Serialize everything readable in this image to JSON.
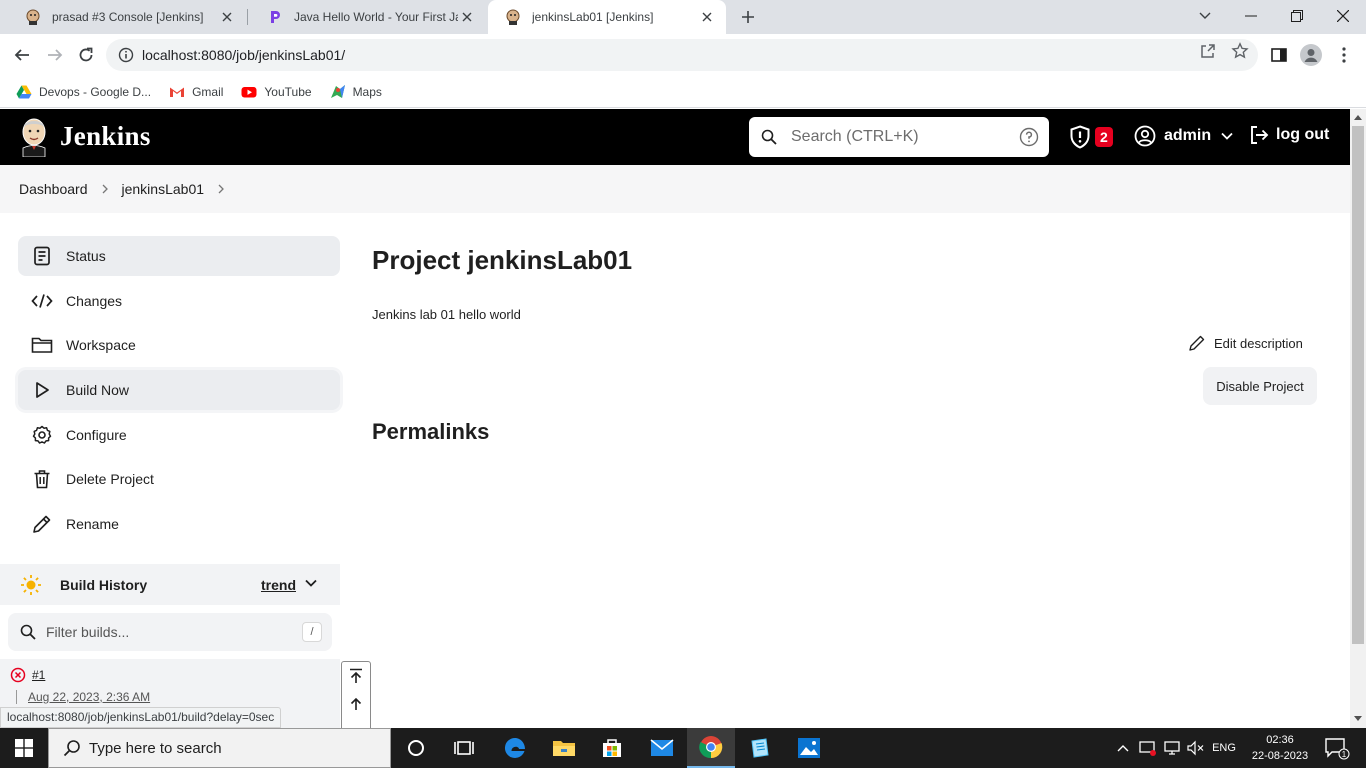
{
  "browser": {
    "tabs": [
      {
        "title": "prasad #3 Console [Jenkins]",
        "active": false
      },
      {
        "title": "Java Hello World - Your First Java",
        "active": false
      },
      {
        "title": "jenkinsLab01 [Jenkins]",
        "active": true
      }
    ],
    "url": "localhost:8080/job/jenkinsLab01/",
    "bookmarks": [
      {
        "label": "Devops - Google D...",
        "icon": "google-drive-icon"
      },
      {
        "label": "Gmail",
        "icon": "gmail-icon"
      },
      {
        "label": "YouTube",
        "icon": "youtube-icon"
      },
      {
        "label": "Maps",
        "icon": "maps-icon"
      }
    ],
    "status_url": "localhost:8080/job/jenkinsLab01/build?delay=0sec"
  },
  "jenkins": {
    "app_name": "Jenkins",
    "search_placeholder": "Search (CTRL+K)",
    "security_count": "2",
    "user": "admin",
    "logout": "log out",
    "breadcrumb": [
      "Dashboard",
      "jenkinsLab01"
    ],
    "sidebar": [
      {
        "label": "Status",
        "icon": "status-icon"
      },
      {
        "label": "Changes",
        "icon": "code-icon"
      },
      {
        "label": "Workspace",
        "icon": "folder-icon"
      },
      {
        "label": "Build Now",
        "icon": "play-icon"
      },
      {
        "label": "Configure",
        "icon": "gear-icon"
      },
      {
        "label": "Delete Project",
        "icon": "trash-icon"
      },
      {
        "label": "Rename",
        "icon": "pencil-icon"
      }
    ],
    "build_history": {
      "title": "Build History",
      "trend": "trend",
      "filter_placeholder": "Filter builds...",
      "filter_shortcut": "/",
      "builds": [
        {
          "number": "#1",
          "date": "Aug 22, 2023, 2:36 AM",
          "status": "failed"
        }
      ]
    },
    "project": {
      "title": "Project jenkinsLab01",
      "description": "Jenkins lab 01 hello world",
      "edit_description": "Edit description",
      "disable_button": "Disable Project",
      "permalinks_heading": "Permalinks"
    }
  },
  "taskbar": {
    "search_placeholder": "Type here to search",
    "language": "ENG",
    "time": "02:36",
    "date": "22-08-2023",
    "notifications": "1"
  },
  "colors": {
    "jenkins_header": "#000000",
    "security_badge": "#e6001f",
    "build_failed": "#e6001f",
    "taskbar": "#1c1c1c"
  }
}
